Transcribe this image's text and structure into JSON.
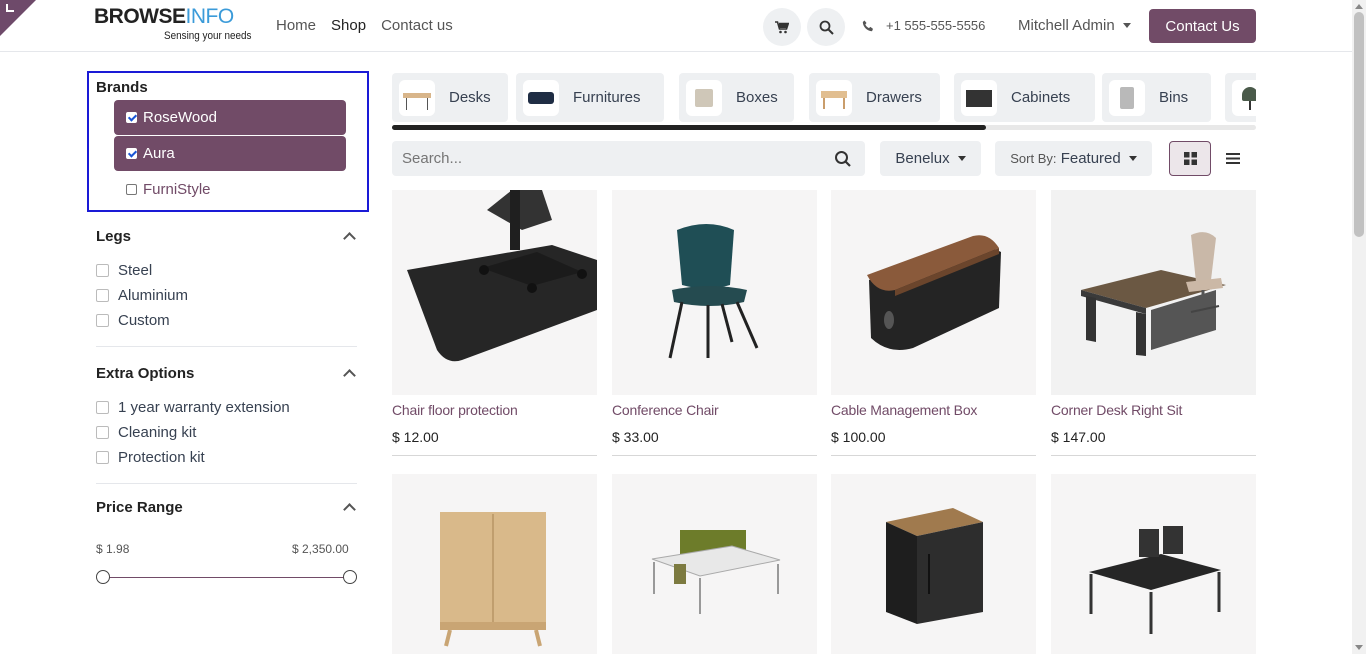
{
  "header": {
    "logo_main": "BROWSE",
    "logo_accent": "INFO",
    "logo_tagline": "Sensing your needs",
    "nav": [
      "Home",
      "Shop",
      "Contact us"
    ],
    "active_nav": "Shop",
    "phone": "+1 555-555-5556",
    "user": "Mitchell Admin",
    "contact_button": "Contact Us",
    "accent_color": "#714b67"
  },
  "sidebar": {
    "brands": {
      "title": "Brands",
      "items": [
        {
          "label": "RoseWood",
          "checked": true
        },
        {
          "label": "Aura",
          "checked": true
        },
        {
          "label": "FurniStyle",
          "checked": false
        }
      ]
    },
    "legs": {
      "title": "Legs",
      "items": [
        "Steel",
        "Aluminium",
        "Custom"
      ]
    },
    "extra_options": {
      "title": "Extra Options",
      "items": [
        "1 year warranty extension",
        "Cleaning kit",
        "Protection kit"
      ]
    },
    "price_range": {
      "title": "Price Range",
      "min": "$ 1.98",
      "max": "$ 2,350.00"
    }
  },
  "categories": [
    "Desks",
    "Furnitures",
    "Boxes",
    "Drawers",
    "Cabinets",
    "Bins"
  ],
  "toolbar": {
    "search_placeholder": "Search...",
    "pricelist": "Benelux",
    "sort_label": "Sort By:",
    "sort_value": "Featured"
  },
  "products": [
    {
      "name": "Chair floor protection",
      "price": "$ 12.00"
    },
    {
      "name": "Conference Chair",
      "price": "$ 33.00"
    },
    {
      "name": "Cable Management Box",
      "price": "$ 100.00"
    },
    {
      "name": "Corner Desk Right Sit",
      "price": "$ 147.00"
    }
  ]
}
